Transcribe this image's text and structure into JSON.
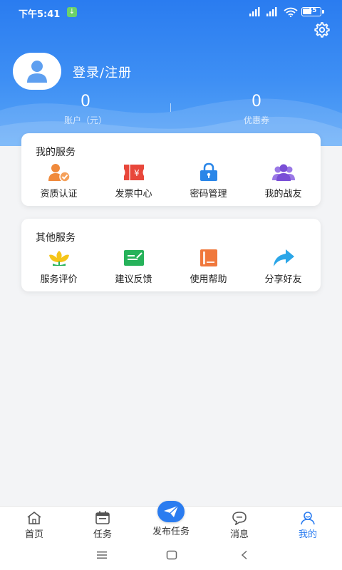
{
  "status_bar": {
    "time": "下午5:41",
    "battery": "45",
    "signal_left": "HD",
    "signal_right": "HD"
  },
  "header": {
    "login_label": "登录/注册",
    "stats": [
      {
        "value": "0",
        "label": "账户（元）"
      },
      {
        "value": "0",
        "label": "优惠券"
      }
    ],
    "background_color": "#2a7cf0"
  },
  "my_services": {
    "title": "我的服务",
    "items": [
      {
        "label": "资质认证",
        "icon": "certificate-user-icon",
        "color": "#f08a3c"
      },
      {
        "label": "发票中心",
        "icon": "invoice-icon",
        "color": "#e8473b"
      },
      {
        "label": "密码管理",
        "icon": "lock-icon",
        "color": "#2a86e8"
      },
      {
        "label": "我的战友",
        "icon": "group-users-icon",
        "color": "#7a4fd6"
      }
    ]
  },
  "other_services": {
    "title": "其他服务",
    "items": [
      {
        "label": "服务评价",
        "icon": "flower-rating-icon",
        "color": "#f5c518"
      },
      {
        "label": "建议反馈",
        "icon": "feedback-icon",
        "color": "#26b25a"
      },
      {
        "label": "使用帮助",
        "icon": "help-book-icon",
        "color": "#f0783c"
      },
      {
        "label": "分享好友",
        "icon": "share-arrow-icon",
        "color": "#2ba6e8"
      }
    ]
  },
  "tab_bar": {
    "tabs": [
      {
        "label": "首页",
        "icon": "home-icon",
        "active": false
      },
      {
        "label": "任务",
        "icon": "calendar-task-icon",
        "active": false
      },
      {
        "label": "发布任务",
        "icon": "paper-plane-icon",
        "active": false
      },
      {
        "label": "消息",
        "icon": "chat-bubble-icon",
        "active": false
      },
      {
        "label": "我的",
        "icon": "profile-icon",
        "active": true
      }
    ],
    "active_color": "#2a7cf0"
  }
}
